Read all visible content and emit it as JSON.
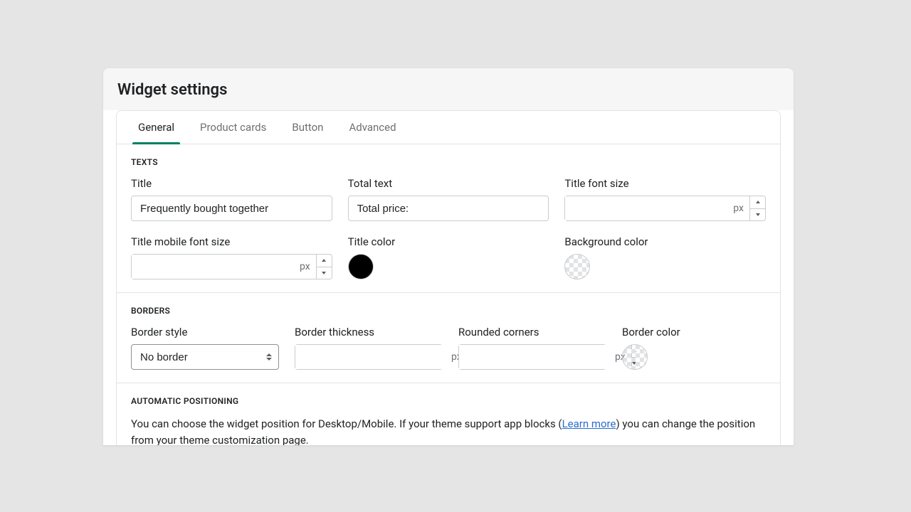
{
  "header": {
    "title": "Widget settings"
  },
  "tabs": {
    "items": [
      "General",
      "Product cards",
      "Button",
      "Advanced"
    ],
    "active_index": 0
  },
  "sections": {
    "texts": {
      "heading": "Texts",
      "title_label": "Title",
      "title_value": "Frequently bought together",
      "total_text_label": "Total text",
      "total_text_value": "Total price:",
      "title_font_size_label": "Title font size",
      "title_font_size_unit": "px",
      "title_mobile_font_size_label": "Title mobile font size",
      "title_mobile_font_size_unit": "px",
      "title_color_label": "Title color",
      "title_color": "#000000",
      "background_color_label": "Background color",
      "background_color": "transparent"
    },
    "borders": {
      "heading": "Borders",
      "border_style_label": "Border style",
      "border_style_value": "No border",
      "border_thickness_label": "Border thickness",
      "border_thickness_unit": "px",
      "rounded_corners_label": "Rounded corners",
      "rounded_corners_unit": "px",
      "border_color_label": "Border color",
      "border_color": "transparent"
    },
    "positioning": {
      "heading": "Automatic positioning",
      "text_before": "You can choose the widget position for Desktop/Mobile. If your theme support app blocks (",
      "link_text": "Learn more",
      "text_after": ") you can change the position from your theme customization page."
    }
  }
}
